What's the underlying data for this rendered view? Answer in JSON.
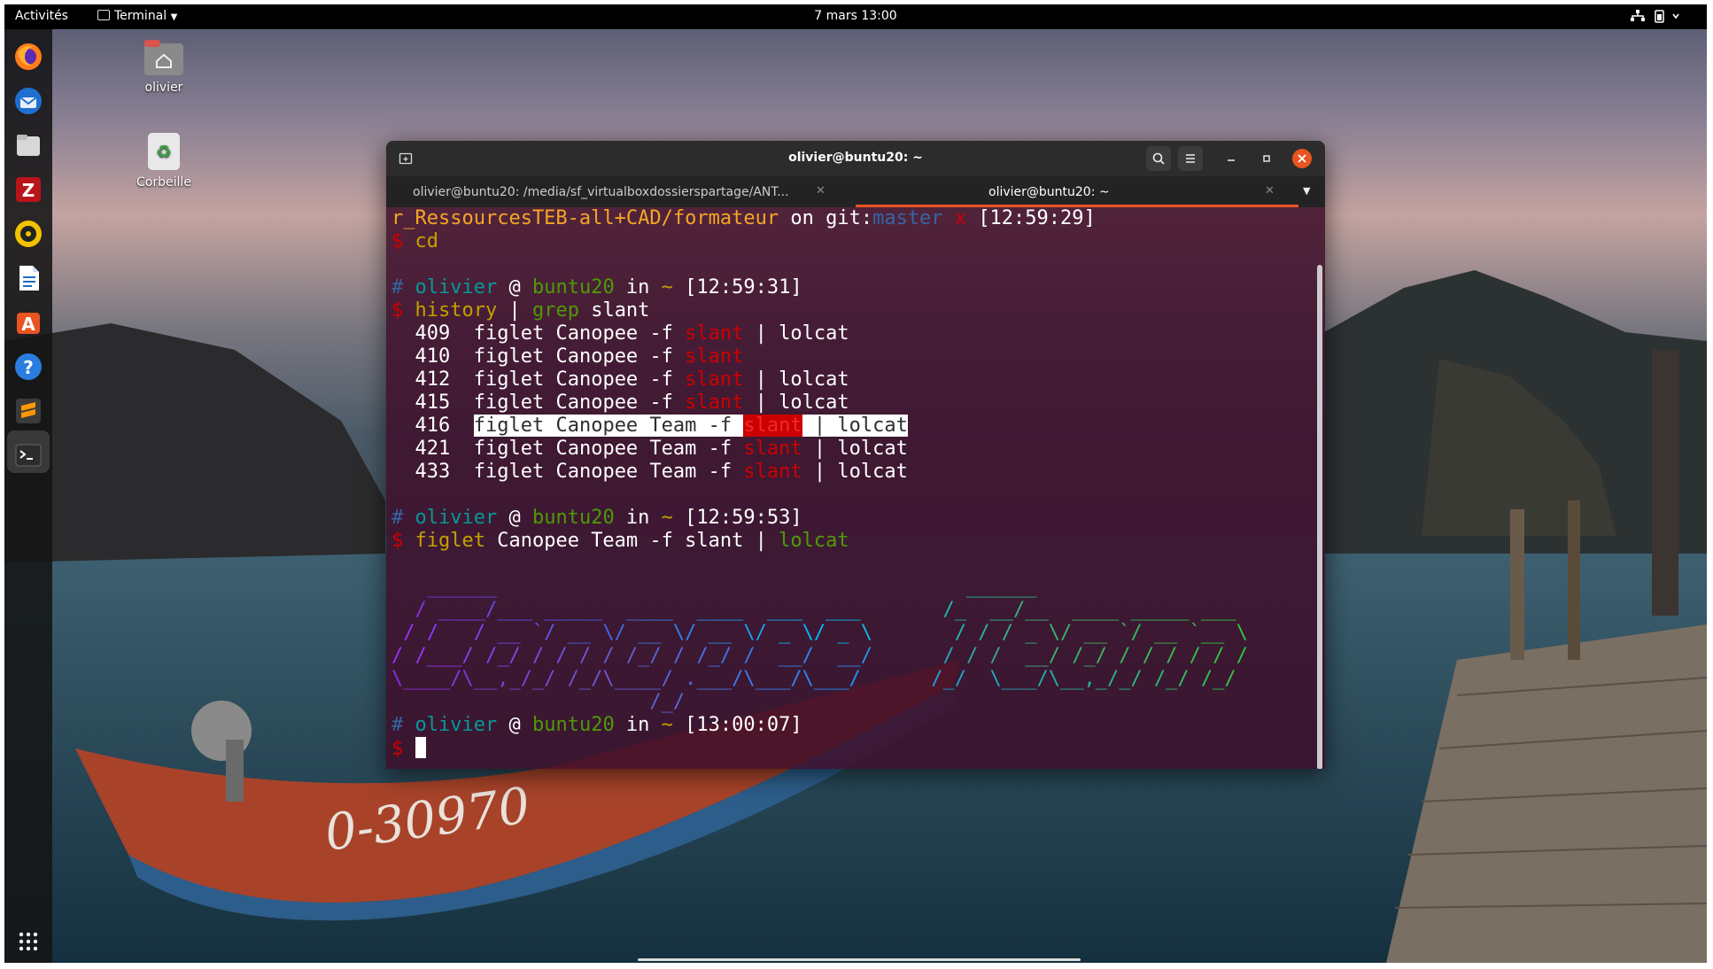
{
  "topbar": {
    "activities": "Activités",
    "app_name": "Terminal",
    "clock": "7 mars  13:00"
  },
  "desktop": {
    "home_label": "olivier",
    "trash_label": "Corbeille"
  },
  "dock": {
    "items": [
      "firefox-icon",
      "thunderbird-icon",
      "files-icon",
      "filezilla-icon",
      "rhythmbox-icon",
      "libreoffice-writer-icon",
      "software-icon",
      "help-icon",
      "sublime-text-icon",
      "terminal-icon"
    ],
    "show_apps": "show-apps-icon"
  },
  "window": {
    "title": "olivier@buntu20: ~",
    "tabs": [
      {
        "label": "olivier@buntu20: /media/sf_virtualboxdossierspartage/ANT..."
      },
      {
        "label": "olivier@buntu20: ~"
      }
    ]
  },
  "terminal": {
    "l0_path": "r_RessourcesTEB-all+CAD/formateur",
    "l0_on": " on ",
    "l0_git": "git",
    "l0_colon": ":",
    "l0_branch": "master",
    "l0_x": " x ",
    "l0_time": "[12:59:29]",
    "dollar": "$",
    "hash": "#",
    "cmd_cd": "cd",
    "user": "olivier",
    "at": " @ ",
    "host": "buntu20",
    "in": " in ",
    "tilde": "~",
    "p1_time": "[12:59:31]",
    "p1_cmd_history": "history",
    "p1_pipe": " | ",
    "p1_cmd_grep": "grep",
    "p1_arg": " slant",
    "history": [
      {
        "num": "409",
        "pre": "figlet Canopee -f ",
        "match": "slant",
        "post": " | lolcat"
      },
      {
        "num": "410",
        "pre": "figlet Canopee -f ",
        "match": "slant",
        "post": ""
      },
      {
        "num": "412",
        "pre": "figlet Canopee -f ",
        "match": "slant",
        "post": " | lolcat"
      },
      {
        "num": "415",
        "pre": "figlet Canopee -f ",
        "match": "slant",
        "post": " | lolcat"
      },
      {
        "num": "416",
        "pre": "figlet Canopee Team -f ",
        "match": "slant",
        "post": " | lolcat"
      },
      {
        "num": "421",
        "pre": "figlet Canopee Team -f ",
        "match": "slant",
        "post": " | lolcat"
      },
      {
        "num": "433",
        "pre": "figlet Canopee Team -f ",
        "match": "slant",
        "post": " | lolcat"
      }
    ],
    "p2_time": "[12:59:53]",
    "p2_cmd_figlet": "figlet",
    "p2_args": " Canopee Team -f slant | ",
    "p2_cmd_lolcat": "lolcat",
    "p3_time": "[13:00:07]",
    "ascii_art": [
      "   ______                                        ______                    ",
      "  / ____/___ _____  ____  ____  ___  ___       /_  __/__  ____ _____ ___ ",
      " / /   / __ `/ __ \\/ __ \\/ __ \\/ _ \\/ _ \\       / / / _ \\/ __ `/ __ `__ \\",
      "/ /___/ /_/ / / / / /_/ / /_/ /  __/  __/      / / /  __/ /_/ / / / / / /",
      "\\____/\\__,_/_/ /_/\\____/ .___/\\___/\\___/      /_/  \\___/\\__,_/_/ /_/ /_/ ",
      "                      /_/                                                "
    ]
  },
  "colors": {
    "terminal_bg": "#3e0e2a",
    "prompt_green": "#4e9a06",
    "path_yellow": "#c4a000",
    "match_red": "#cc0000",
    "close_button": "#e95420"
  }
}
